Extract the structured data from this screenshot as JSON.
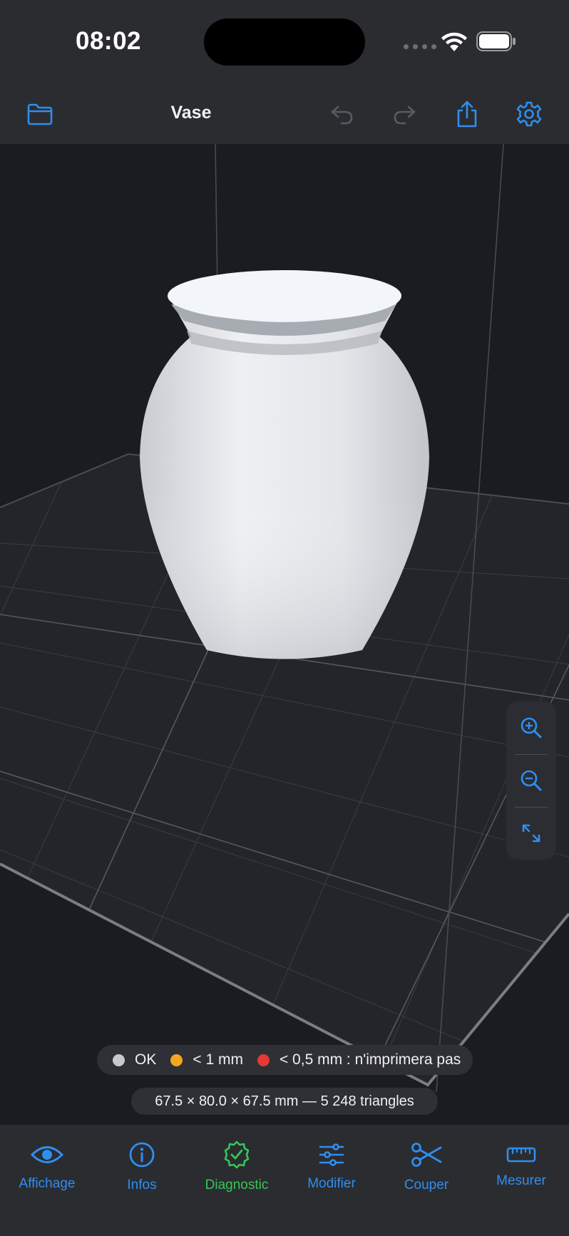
{
  "status_bar": {
    "time": "08:02"
  },
  "toolbar": {
    "title": "Vase"
  },
  "legend": {
    "items": [
      {
        "label": "OK",
        "color": "#c8c9cd"
      },
      {
        "label": "< 1 mm",
        "color": "#f5a623"
      },
      {
        "label": "< 0,5 mm : n'imprimera pas",
        "color": "#e53935"
      }
    ]
  },
  "model_info": "67.5 × 80.0 × 67.5 mm — 5 248 triangles",
  "tabs": [
    {
      "label": "Affichage",
      "icon": "eye-icon"
    },
    {
      "label": "Infos",
      "icon": "info-icon"
    },
    {
      "label": "Diagnostic",
      "icon": "check-seal-icon",
      "active": true
    },
    {
      "label": "Modifier",
      "icon": "sliders-icon"
    },
    {
      "label": "Couper",
      "icon": "scissors-icon"
    },
    {
      "label": "Mesurer",
      "icon": "ruler-icon"
    }
  ],
  "colors": {
    "accent": "#2f8ef0",
    "active": "#34c759",
    "disabled": "#5a5b60"
  }
}
